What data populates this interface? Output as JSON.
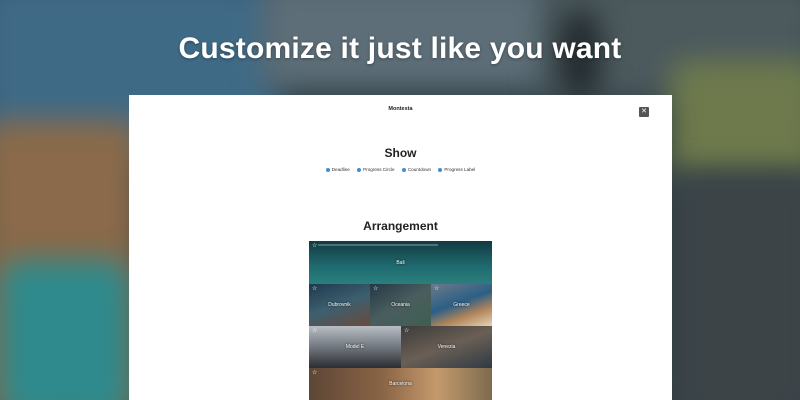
{
  "headline": "Customize it just like you want",
  "panel": {
    "title": "Montesta",
    "close_icon": "close-icon"
  },
  "show": {
    "title": "Show",
    "options": [
      {
        "label": "Deadline",
        "checked": true
      },
      {
        "label": "Progress Circle",
        "checked": true
      },
      {
        "label": "Countdown",
        "checked": true
      },
      {
        "label": "Progress Label",
        "checked": true
      }
    ]
  },
  "arrangement": {
    "title": "Arrangement",
    "tiles": [
      {
        "label": "Bali",
        "starred": true
      },
      {
        "label": "Dubrovnik",
        "starred": true
      },
      {
        "label": "Oceania",
        "starred": true
      },
      {
        "label": "Greece",
        "starred": true
      },
      {
        "label": "Model E",
        "starred": true
      },
      {
        "label": "Venezia",
        "starred": true
      },
      {
        "label": "Barcelona",
        "starred": true
      }
    ]
  }
}
